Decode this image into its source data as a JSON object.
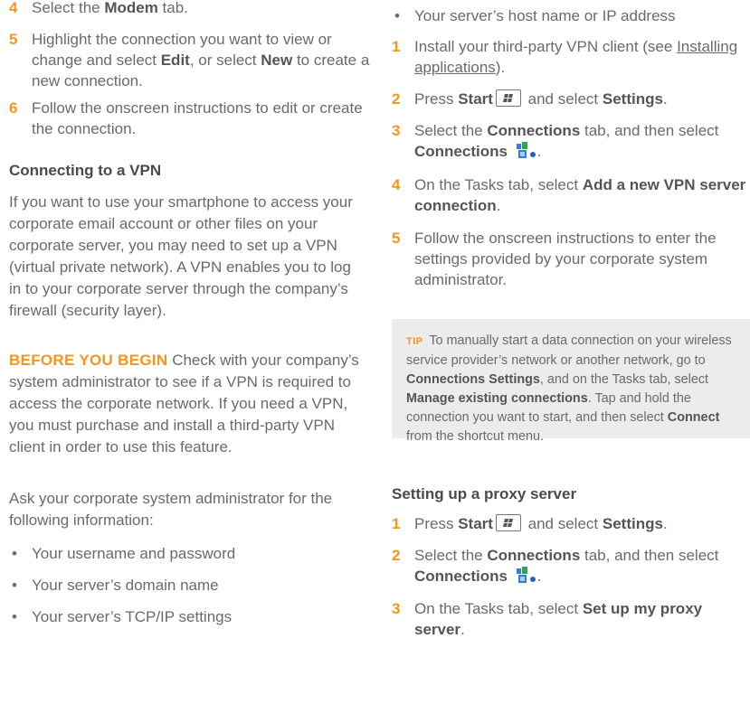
{
  "left": {
    "step4": {
      "num": "4",
      "pre": "Select the ",
      "bold": "Modem",
      "post": " tab."
    },
    "step5": {
      "num": "5",
      "pre": "Highlight the connection you want to view or change and select ",
      "bold1": "Edit",
      "mid": ", or select ",
      "bold2": "New",
      "post": " to create a new connection."
    },
    "step6": {
      "num": "6",
      "text": "Follow the onscreen instructions to edit or create the connection."
    },
    "vpn_heading": "Connecting to a VPN",
    "vpn_intro": "If you want to use your smartphone to access your corporate email account or other files on your corporate server, you may need to set up a VPN (virtual private network). A VPN enables you to log in to your corporate server through the company’s firewall (security layer).",
    "before_label": "BEFORE YOU BEGIN",
    "before_text": "  Check with your company’s system administrator to see if a VPN is required to access the corporate network. If you need a VPN, you must purchase and install a third-party VPN client in order to use this feature.",
    "ask_text": "Ask your corporate system administrator for the following information:",
    "bullets": [
      "Your username and password",
      "Your server’s domain name",
      "Your server’s TCP/IP settings"
    ]
  },
  "right": {
    "bullet_top": "Your server’s host name or IP address",
    "step1": {
      "num": "1",
      "pre": "Install your third-party VPN client (see ",
      "link": "Installing applications",
      "post": ")."
    },
    "step2": {
      "num": "2",
      "pre": "Press ",
      "bold1": "Start",
      "mid": " and select ",
      "bold2": "Settings",
      "post": "."
    },
    "step3": {
      "num": "3",
      "pre": "Select the ",
      "bold1": "Connections",
      "mid": " tab, and then select ",
      "bold2": "Connections",
      "post": "."
    },
    "step4": {
      "num": "4",
      "pre": "On the Tasks tab, select ",
      "bold": "Add a new VPN server connection",
      "post": "."
    },
    "step5": {
      "num": "5",
      "text": "Follow the onscreen instructions to enter the settings provided by your corporate system administrator."
    },
    "tip": {
      "label": "TIP",
      "t1": " To manually start a data connection on your wireless service provider’s network or another network, go to ",
      "b1": "Connections Settings",
      "t2": ", and on the Tasks tab, select ",
      "b2": "Manage existing connections",
      "t3": ". Tap and hold the connection you want to start, and then select ",
      "b3": "Connect",
      "t4": " from the shortcut menu."
    },
    "proxy_heading": "Setting up a proxy server",
    "p1": {
      "num": "1",
      "pre": "Press ",
      "bold1": "Start",
      "mid": " and select ",
      "bold2": "Settings",
      "post": "."
    },
    "p2": {
      "num": "2",
      "pre": "Select the ",
      "bold1": "Connections",
      "mid": " tab, and then select ",
      "bold2": "Connections",
      "post": "."
    },
    "p3": {
      "num": "3",
      "pre": "On the Tasks tab, select ",
      "bold": "Set up my proxy server",
      "post": "."
    }
  }
}
